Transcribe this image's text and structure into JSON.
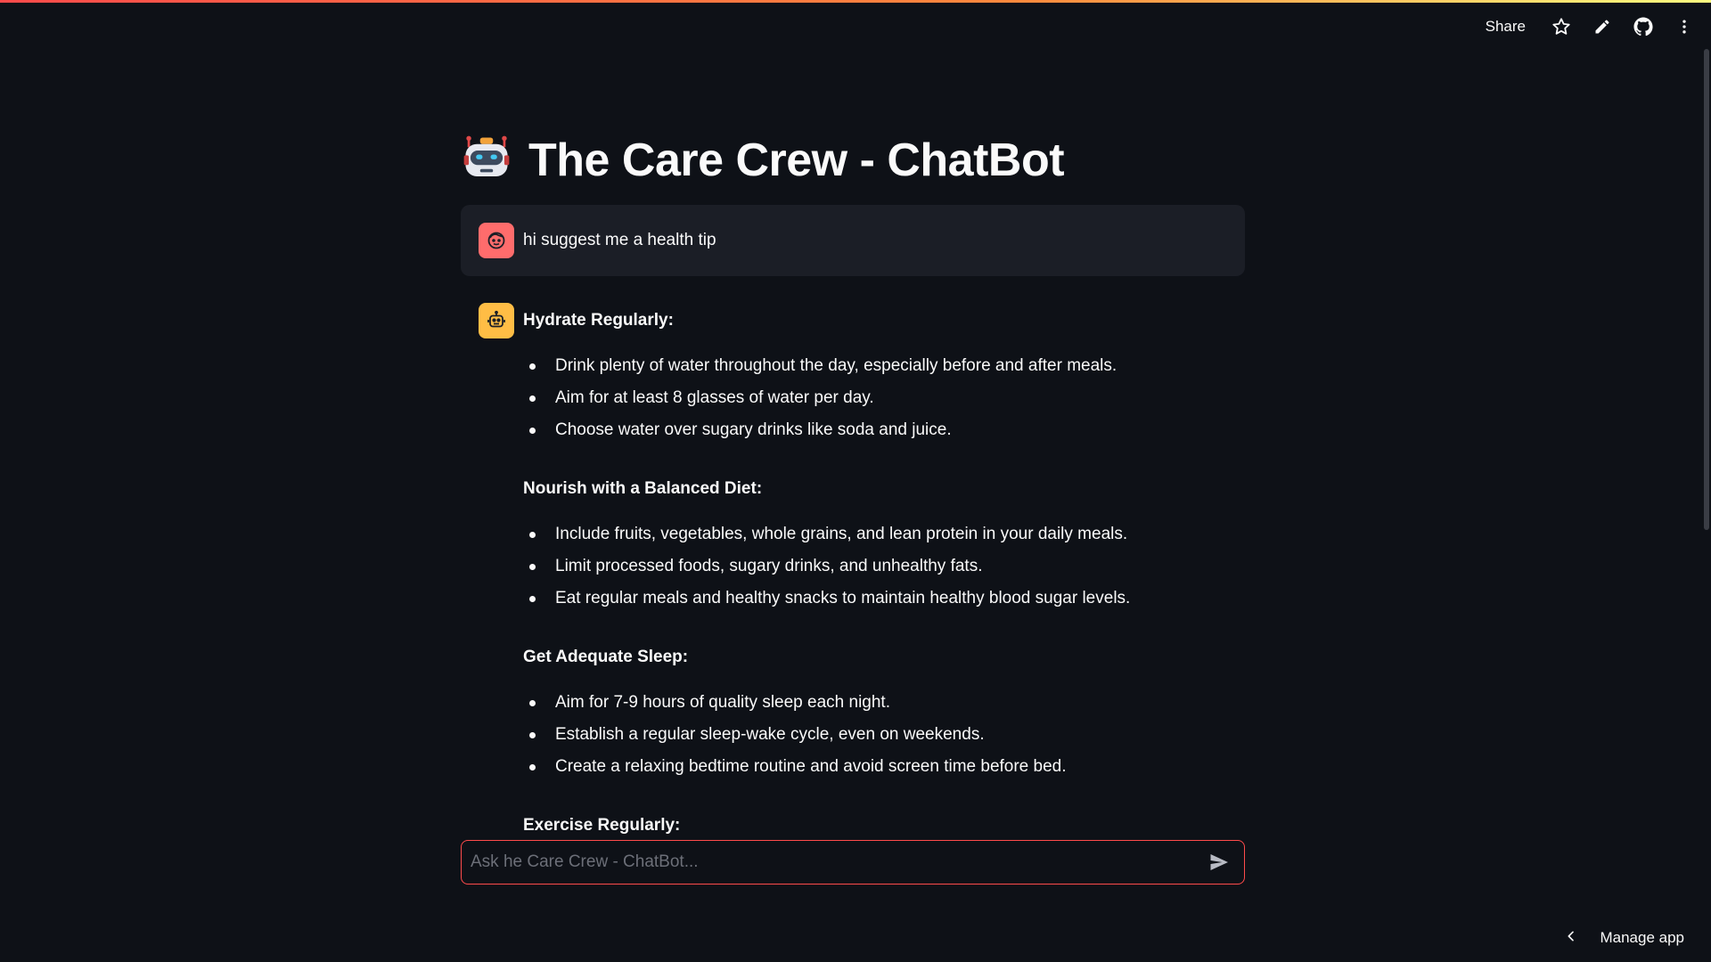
{
  "toolbar": {
    "share_label": "Share",
    "icons": [
      "star-icon",
      "pencil-icon",
      "github-icon",
      "more-vert-icon"
    ]
  },
  "header": {
    "title": "The Care Crew - ChatBot",
    "title_icon": "robot-icon"
  },
  "messages": {
    "user": {
      "avatar_icon": "user-face-icon",
      "text": "hi suggest me a health tip"
    },
    "assistant": {
      "avatar_icon": "bot-icon",
      "sections": [
        {
          "title": "Hydrate Regularly:",
          "items": [
            "Drink plenty of water throughout the day, especially before and after meals.",
            "Aim for at least 8 glasses of water per day.",
            "Choose water over sugary drinks like soda and juice."
          ]
        },
        {
          "title": "Nourish with a Balanced Diet:",
          "items": [
            "Include fruits, vegetables, whole grains, and lean protein in your daily meals.",
            "Limit processed foods, sugary drinks, and unhealthy fats.",
            "Eat regular meals and healthy snacks to maintain healthy blood sugar levels."
          ]
        },
        {
          "title": "Get Adequate Sleep:",
          "items": [
            "Aim for 7-9 hours of quality sleep each night.",
            "Establish a regular sleep-wake cycle, even on weekends.",
            "Create a relaxing bedtime routine and avoid screen time before bed."
          ]
        },
        {
          "title": "Exercise Regularly:",
          "items": []
        }
      ]
    }
  },
  "chat_input": {
    "placeholder": "Ask he Care Crew - ChatBot...",
    "value": ""
  },
  "footer": {
    "manage_label": "Manage app"
  },
  "colors": {
    "background": "#0e1117",
    "accent": "#ff4b4b",
    "user_avatar": "#ff6c6c",
    "bot_avatar": "#ffbd45",
    "user_bubble": "#1b1e26"
  }
}
